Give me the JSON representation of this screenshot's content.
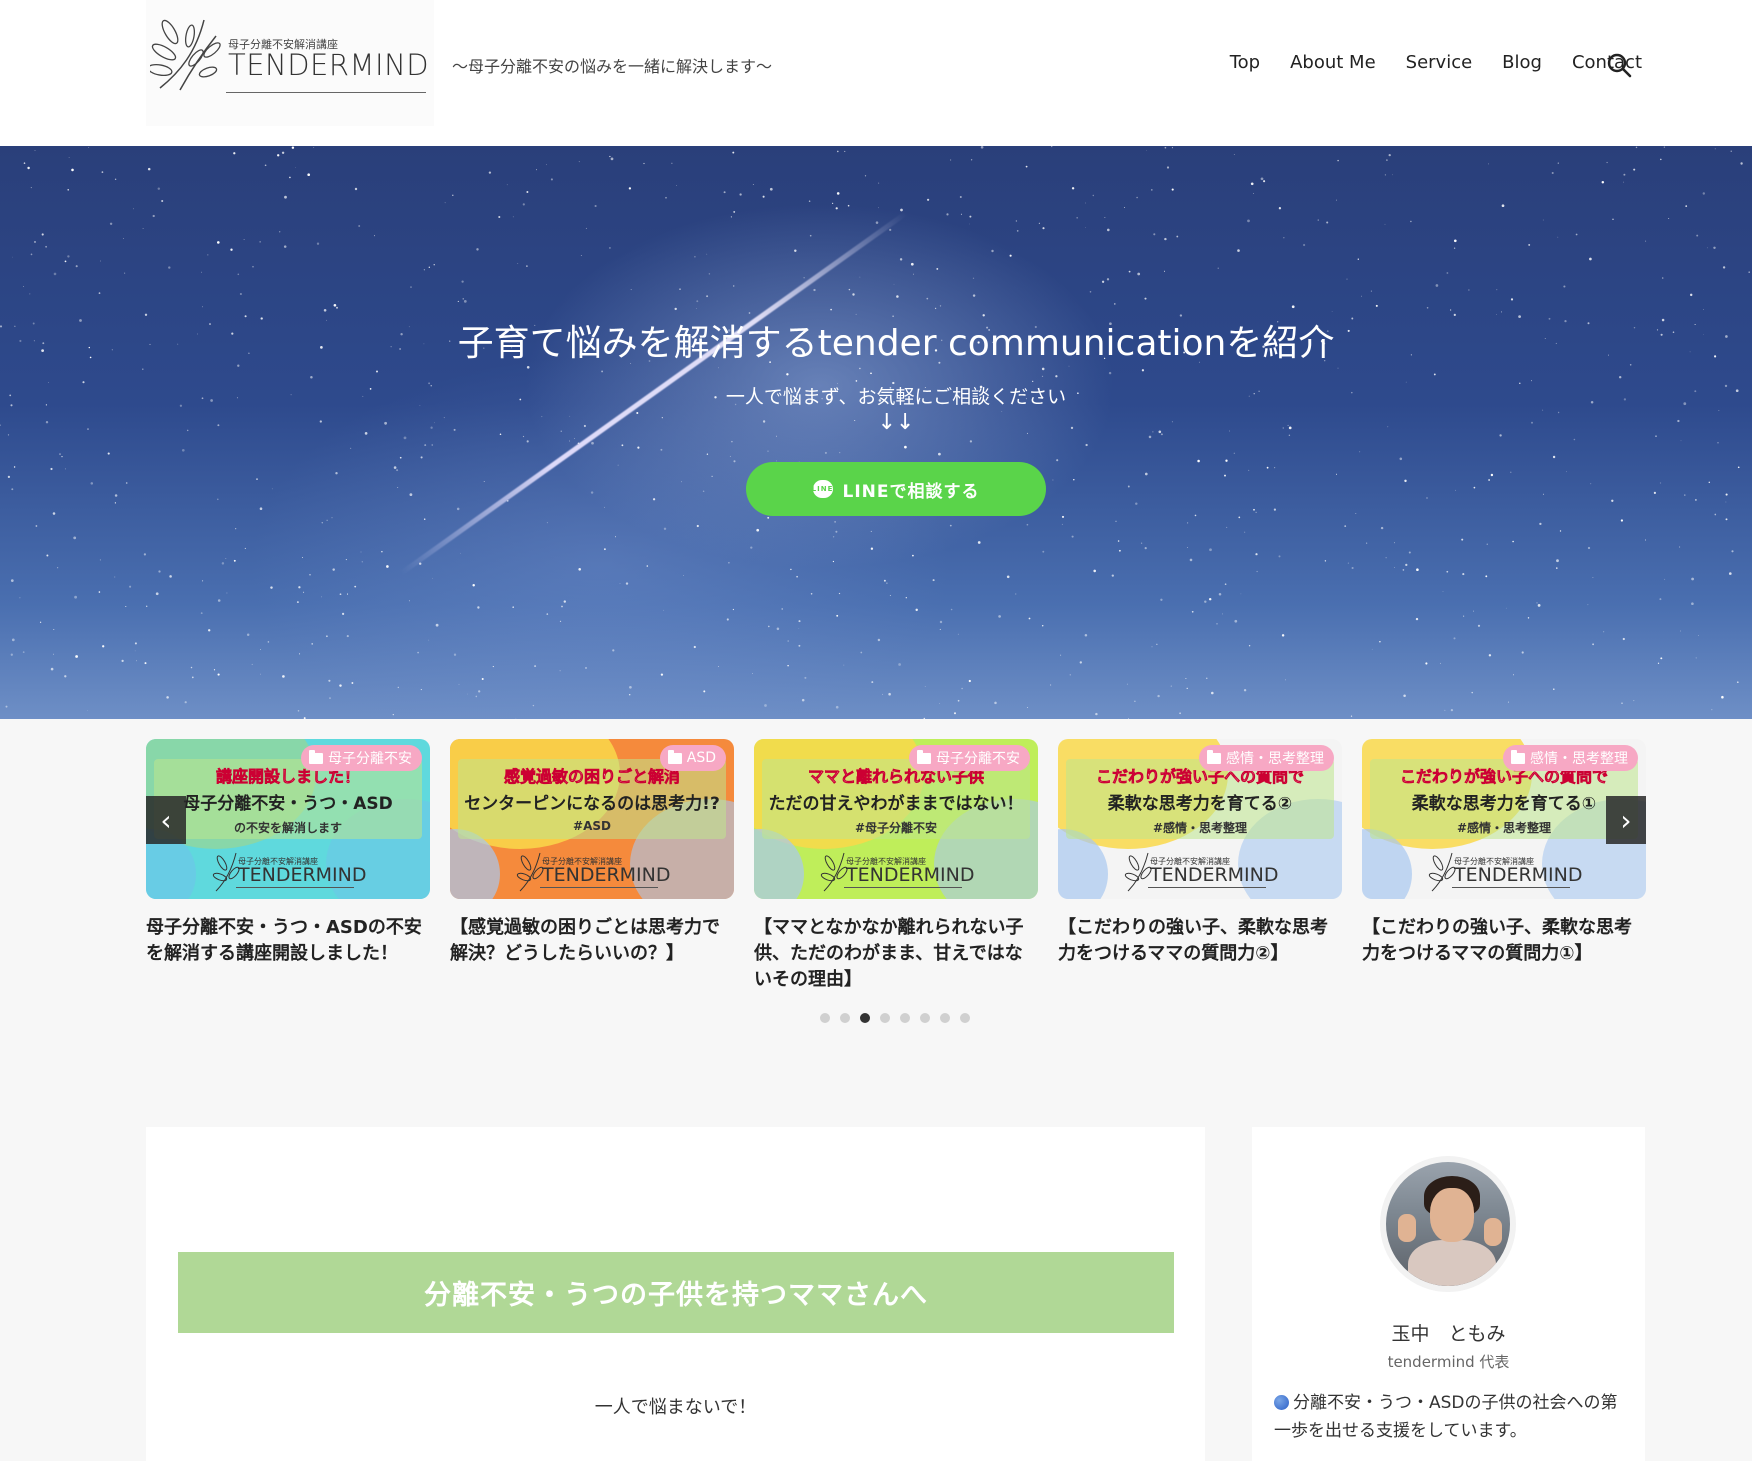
{
  "header": {
    "logo_sub": "母子分離不安解消講座",
    "logo_main": "TENDERMIND",
    "tagline": "〜母子分離不安の悩みを一緒に解決します〜",
    "nav": [
      "Top",
      "About Me",
      "Service",
      "Blog",
      "Contact"
    ],
    "search_icon": "search-icon"
  },
  "hero": {
    "title": "子育て悩みを解消するtender communicationを紹介",
    "subtitle": "一人で悩まず、お気軽にご相談ください",
    "arrows": "↓↓",
    "button_label": "LINEで相談する",
    "button_icon_text": "LINE",
    "button_color": "#5ad44a"
  },
  "carousel": {
    "prev_icon": "chevron-left-icon",
    "next_icon": "chevron-right-icon",
    "prev_glyph": "‹",
    "next_glyph": "›",
    "dot_count": 8,
    "active_dot": 3,
    "cards": [
      {
        "badge": "母子分離不安",
        "thumb_line1": "講座開設しました！",
        "thumb_line2": "母子分離不安・うつ・ASD",
        "thumb_line3": "の不安を解消します",
        "thumb_logo_sub": "母子分離不安解消講座",
        "thumb_logo": "TENDERMIND",
        "title": "母子分離不安・うつ・ASDの不安を解消する講座開設しました！",
        "bg": "#5fd9dd"
      },
      {
        "badge": "ASD",
        "thumb_line1": "感覚過敏の困りごと解消",
        "thumb_line2": "センターピンになるのは思考力!?",
        "thumb_line3": "#ASD",
        "thumb_logo_sub": "母子分離不安解消講座",
        "thumb_logo": "TENDERMIND",
        "title": "【感覚過敏の困りごとは思考力で解決？どうしたらいいの？】",
        "bg": "#f58a3c"
      },
      {
        "badge": "母子分離不安",
        "thumb_line1": "ママと離れられない子供",
        "thumb_line2": "ただの甘えやわがままではない！",
        "thumb_line3": "#母子分離不安",
        "thumb_logo_sub": "母子分離不安解消講座",
        "thumb_logo": "TENDERMIND",
        "title": "【ママとなかなか離れられない子供、ただのわがまま、甘えではないその理由】",
        "bg": "#bfee5a"
      },
      {
        "badge": "感情・思考整理",
        "thumb_line1": "こだわりが強い子への質問で",
        "thumb_line2": "柔軟な思考力を育てる②",
        "thumb_line3": "#感情・思考整理",
        "thumb_logo_sub": "母子分離不安解消講座",
        "thumb_logo": "TENDERMIND",
        "title": "【こだわりの強い子、柔軟な思考力をつけるママの質問力②】",
        "bg": "#f4f4f4"
      },
      {
        "badge": "感情・思考整理",
        "thumb_line1": "こだわりが強い子への質問で",
        "thumb_line2": "柔軟な思考力を育てる①",
        "thumb_line3": "#感情・思考整理",
        "thumb_logo_sub": "母子分離不安解消講座",
        "thumb_logo": "TENDERMIND",
        "title": "【こだわりの強い子、柔軟な思考力をつけるママの質問力①】",
        "bg": "#f4f4f4"
      }
    ]
  },
  "main": {
    "heading": "分離不安・うつの子供を持つママさんへ",
    "heading_color": "#b0d896",
    "text": "一人で悩まないで！"
  },
  "sidebar": {
    "name": "玉中　ともみ",
    "role": "tendermind 代表",
    "description": "分離不安・うつ・ASDの子供の社会への第一歩を出せる支援をしています。",
    "bullet_icon": "blue-circle-icon"
  }
}
